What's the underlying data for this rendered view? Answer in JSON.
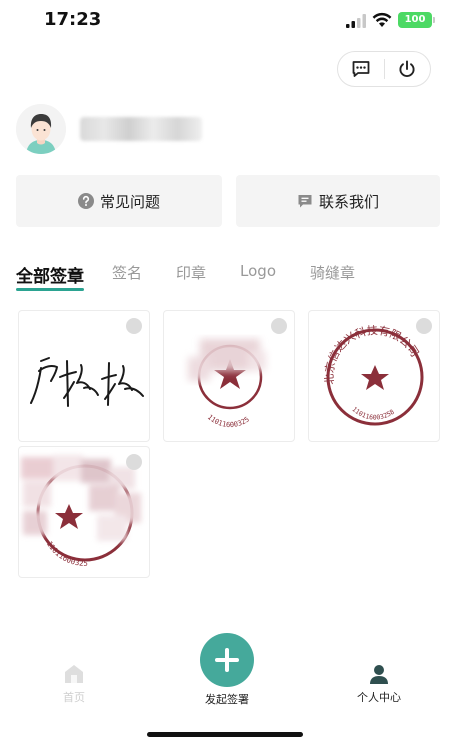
{
  "status_bar": {
    "time": "17:23",
    "battery": "100"
  },
  "top_actions": {
    "message_icon": "message-icon",
    "power_icon": "power-icon"
  },
  "profile": {
    "avatar_icon": "avatar-icon"
  },
  "help_buttons": [
    {
      "label": "常见问题",
      "icon": "question-icon"
    },
    {
      "label": "联系我们",
      "icon": "message-icon"
    }
  ],
  "tabs": [
    {
      "label": "全部签章",
      "active": true
    },
    {
      "label": "签名",
      "active": false
    },
    {
      "label": "印章",
      "active": false
    },
    {
      "label": "Logo",
      "active": false
    },
    {
      "label": "骑缝章",
      "active": false
    }
  ],
  "seals": [
    {
      "type": "signature"
    },
    {
      "type": "seal",
      "code": "11011600325"
    },
    {
      "type": "seal",
      "text": "北京信达兴科技有限公司",
      "code": "110116003258"
    },
    {
      "type": "seal",
      "code": "11011600325"
    }
  ],
  "bottom_nav": {
    "home_label": "首页",
    "create_label": "发起签署",
    "me_label": "个人中心"
  },
  "colors": {
    "accent": "#45a99b",
    "tab_underline": "#2ba391",
    "seal_red": "#8b2f3a"
  }
}
